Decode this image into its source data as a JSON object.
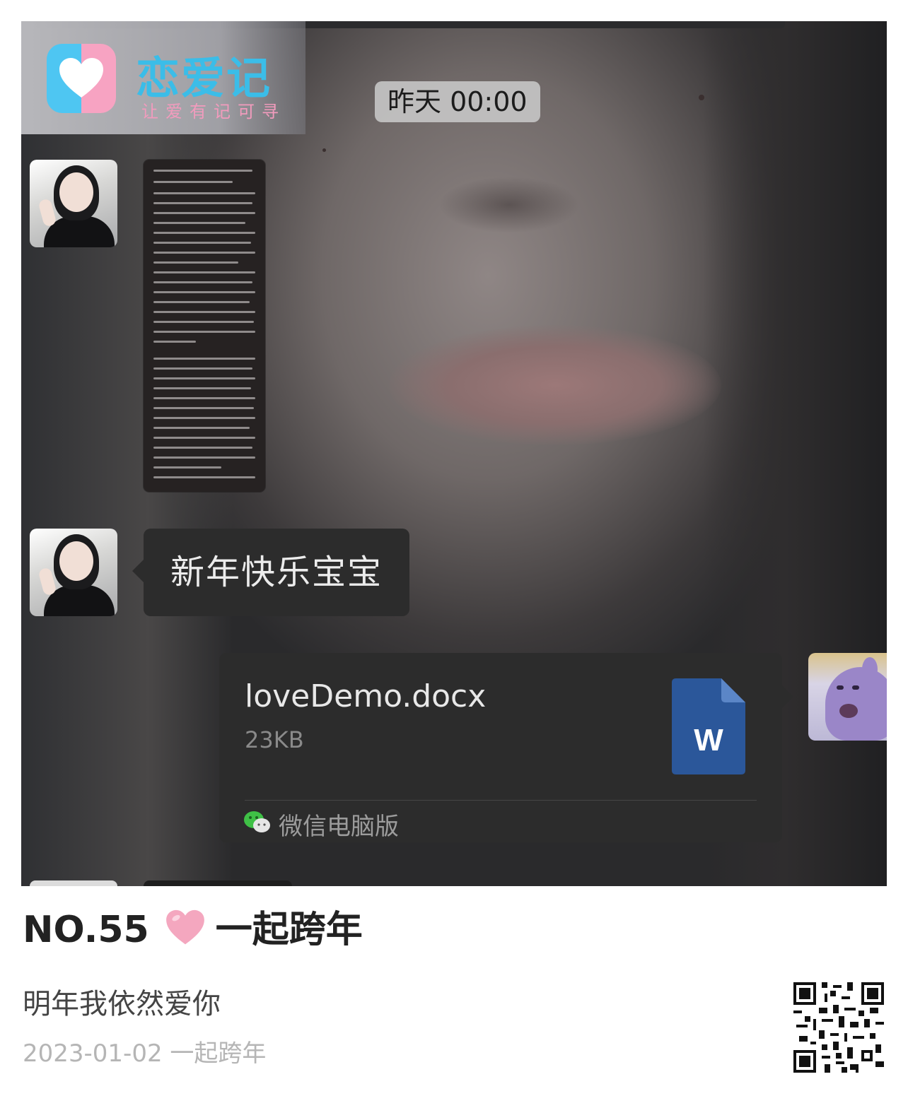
{
  "brand": {
    "name": "恋爱记",
    "tagline": "让爱有记可寻"
  },
  "chat": {
    "timestamp": "昨天 00:00",
    "message_text": "新年快乐宝宝",
    "file": {
      "name": "loveDemo.docx",
      "size": "23KB",
      "type_glyph": "W",
      "source": "微信电脑版"
    }
  },
  "caption": {
    "number": "NO.55",
    "title": "一起跨年",
    "description": "明年我依然爱你",
    "date": "2023-01-02",
    "date_tag": "一起跨年"
  },
  "colors": {
    "brand_blue": "#3bbde8",
    "brand_pink": "#f7a3c2",
    "heart": "#f4a7bf",
    "word_blue": "#2b579a",
    "wechat_green": "#3fc046"
  },
  "icons": [
    "heart-icon",
    "word-file-icon",
    "wechat-icon",
    "qr-code"
  ]
}
